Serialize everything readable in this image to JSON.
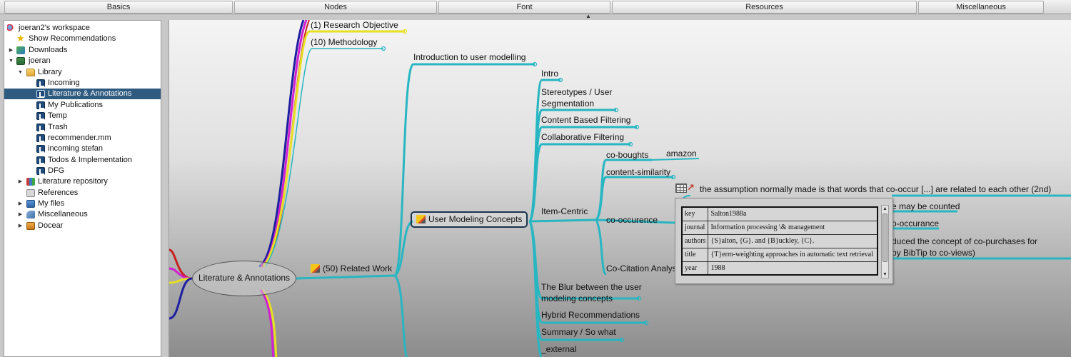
{
  "tabs": [
    {
      "label": "Basics"
    },
    {
      "label": "Nodes"
    },
    {
      "label": "Font"
    },
    {
      "label": "Resources"
    },
    {
      "label": "Miscellaneous"
    }
  ],
  "tree": {
    "items": [
      {
        "label": "joeran2's workspace",
        "icon": "workspace-icon",
        "toggle": ""
      },
      {
        "label": "Show Recommendations",
        "icon": "star-icon",
        "toggle": ""
      },
      {
        "label": "Downloads",
        "icon": "downloads-icon",
        "toggle": "▶"
      },
      {
        "label": "joeran",
        "icon": "project-icon",
        "toggle": "▼"
      },
      {
        "label": "Library",
        "icon": "folder-open-icon",
        "toggle": "▼"
      },
      {
        "label": "Incoming",
        "icon": "mindmap-file-icon",
        "toggle": ""
      },
      {
        "label": "Literature & Annotations",
        "icon": "mindmap-file-icon",
        "toggle": ""
      },
      {
        "label": "My Publications",
        "icon": "mindmap-file-icon",
        "toggle": ""
      },
      {
        "label": "Temp",
        "icon": "mindmap-file-icon",
        "toggle": ""
      },
      {
        "label": "Trash",
        "icon": "mindmap-file-icon",
        "toggle": ""
      },
      {
        "label": "recommender.mm",
        "icon": "mindmap-file-icon",
        "toggle": ""
      },
      {
        "label": "incoming stefan",
        "icon": "mindmap-file-icon",
        "toggle": ""
      },
      {
        "label": "Todos & Implementation",
        "icon": "mindmap-file-icon",
        "toggle": ""
      },
      {
        "label": "DFG",
        "icon": "mindmap-file-icon",
        "toggle": ""
      },
      {
        "label": "Literature repository",
        "icon": "books-icon",
        "toggle": "▶"
      },
      {
        "label": "References",
        "icon": "references-icon",
        "toggle": ""
      },
      {
        "label": "My files",
        "icon": "folder-icon",
        "toggle": "▶"
      },
      {
        "label": "Miscellaneous",
        "icon": "misc-icon",
        "toggle": "▶"
      },
      {
        "label": "Docear",
        "icon": "docear-folder-icon",
        "toggle": "▶"
      }
    ],
    "selected_index": 6
  },
  "map": {
    "root": "Literature & Annotations",
    "research_objective": "(1) Research Objective",
    "methodology": "(10) Methodology",
    "related_work": "(50) Related Work",
    "intro_user_modelling": "Introduction to user modelling",
    "user_modeling_concepts": "User Modeling Concepts",
    "intro": "Intro",
    "stereotypes": "Stereotypes / User Segmentation",
    "content_based": "Content Based Filtering",
    "collaborative": "Collaborative Filtering",
    "item_centric": "Item-Centric",
    "co_boughts": "co-boughts",
    "amazon": "amazon",
    "content_similarity": "content-similarity",
    "co_occurence": "co-occurence",
    "co_citation": "Co-Citation Analys",
    "assumption": "the assumption normally made is that words that co-occur [...] are related to each other (2nd)",
    "may_be_counted": "e may be counted",
    "o_occurance": "o-occurance",
    "co_purchases": "duced the concept of co-purchases for by BibTip to co-views)",
    "blur": "The Blur between the user modeling concepts",
    "hybrid": "Hybrid Recommendations",
    "summary": "Summary / So what",
    "external": "_external"
  },
  "bibtex": [
    {
      "key": "key",
      "value": "Salton1988a"
    },
    {
      "key": "journal",
      "value": "Information processing \\& management"
    },
    {
      "key": "authors",
      "value": "{S}alton, {G}. and {B}uckley, {C}."
    },
    {
      "key": "title",
      "value": "{T}erm-weighting approaches in automatic text retrieval"
    },
    {
      "key": "year",
      "value": "1988"
    }
  ],
  "colors": {
    "edge_primary": "#27b6c2",
    "edge_yellow": "#e8e020",
    "edge_magenta": "#d21fd2",
    "edge_blue": "#1e1ea0",
    "edge_red": "#c81e1e",
    "selection": "#2f5a80"
  }
}
